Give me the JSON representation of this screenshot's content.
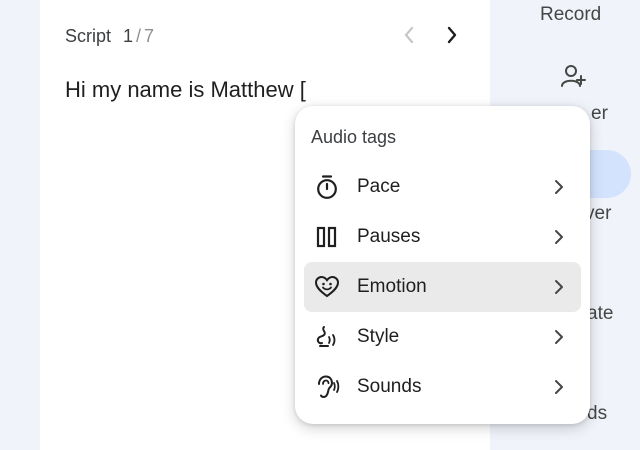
{
  "editor": {
    "label": "Script",
    "page_current": "1",
    "page_separator": "/",
    "page_total": "7",
    "text": "Hi my name is Matthew ["
  },
  "rail": {
    "record_label": "Record",
    "partial_1": "er",
    "partial_2": "ver",
    "partial_3": "ate",
    "partial_4": "ds"
  },
  "menu": {
    "title": "Audio tags",
    "items": [
      {
        "label": "Pace",
        "icon": "timer-icon"
      },
      {
        "label": "Pauses",
        "icon": "pause-icon"
      },
      {
        "label": "Emotion",
        "icon": "emotion-heart-icon"
      },
      {
        "label": "Style",
        "icon": "style-icon"
      },
      {
        "label": "Sounds",
        "icon": "ear-sound-icon"
      }
    ],
    "active_index": 2
  },
  "colors": {
    "background": "#f0f4fa",
    "card": "#ffffff",
    "active_item": "#eaeaea",
    "rail_pill": "#d3e3fd",
    "text": "#1f1f1f"
  }
}
